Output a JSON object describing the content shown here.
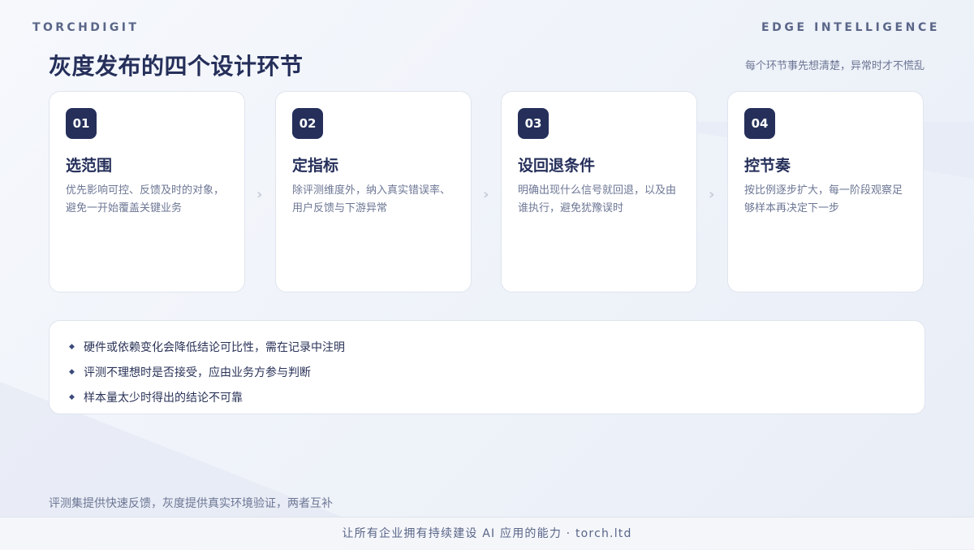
{
  "brand": {
    "left": "TORCHDIGIT",
    "right": "EDGE INTELLIGENCE"
  },
  "header": {
    "title": "灰度发布的四个设计环节",
    "subtitle": "每个环节事先想清楚，异常时才不慌乱"
  },
  "steps": [
    {
      "num": "01",
      "title": "选范围",
      "desc": "优先影响可控、反馈及时的对象，避免一开始覆盖关键业务"
    },
    {
      "num": "02",
      "title": "定指标",
      "desc": "除评测维度外，纳入真实错误率、用户反馈与下游异常"
    },
    {
      "num": "03",
      "title": "设回退条件",
      "desc": "明确出现什么信号就回退，以及由谁执行，避免犹豫误时"
    },
    {
      "num": "04",
      "title": "控节奏",
      "desc": "按比例逐步扩大，每一阶段观察足够样本再决定下一步"
    }
  ],
  "arrow_glyph": "›",
  "notes": [
    "硬件或依赖变化会降低结论可比性，需在记录中注明",
    "评测不理想时是否接受，应由业务方参与判断",
    "样本量太少时得出的结论不可靠"
  ],
  "bullet_glyph": "◆",
  "footnote": "评测集提供快速反馈，灰度提供真实环境验证，两者互补",
  "footer": "让所有企业拥有持续建设 AI 应用的能力 · torch.ltd",
  "colors": {
    "primary": "#252f5a",
    "muted": "#6d7795",
    "card_border": "#dfe4ee",
    "background": "#f0f3f9"
  }
}
